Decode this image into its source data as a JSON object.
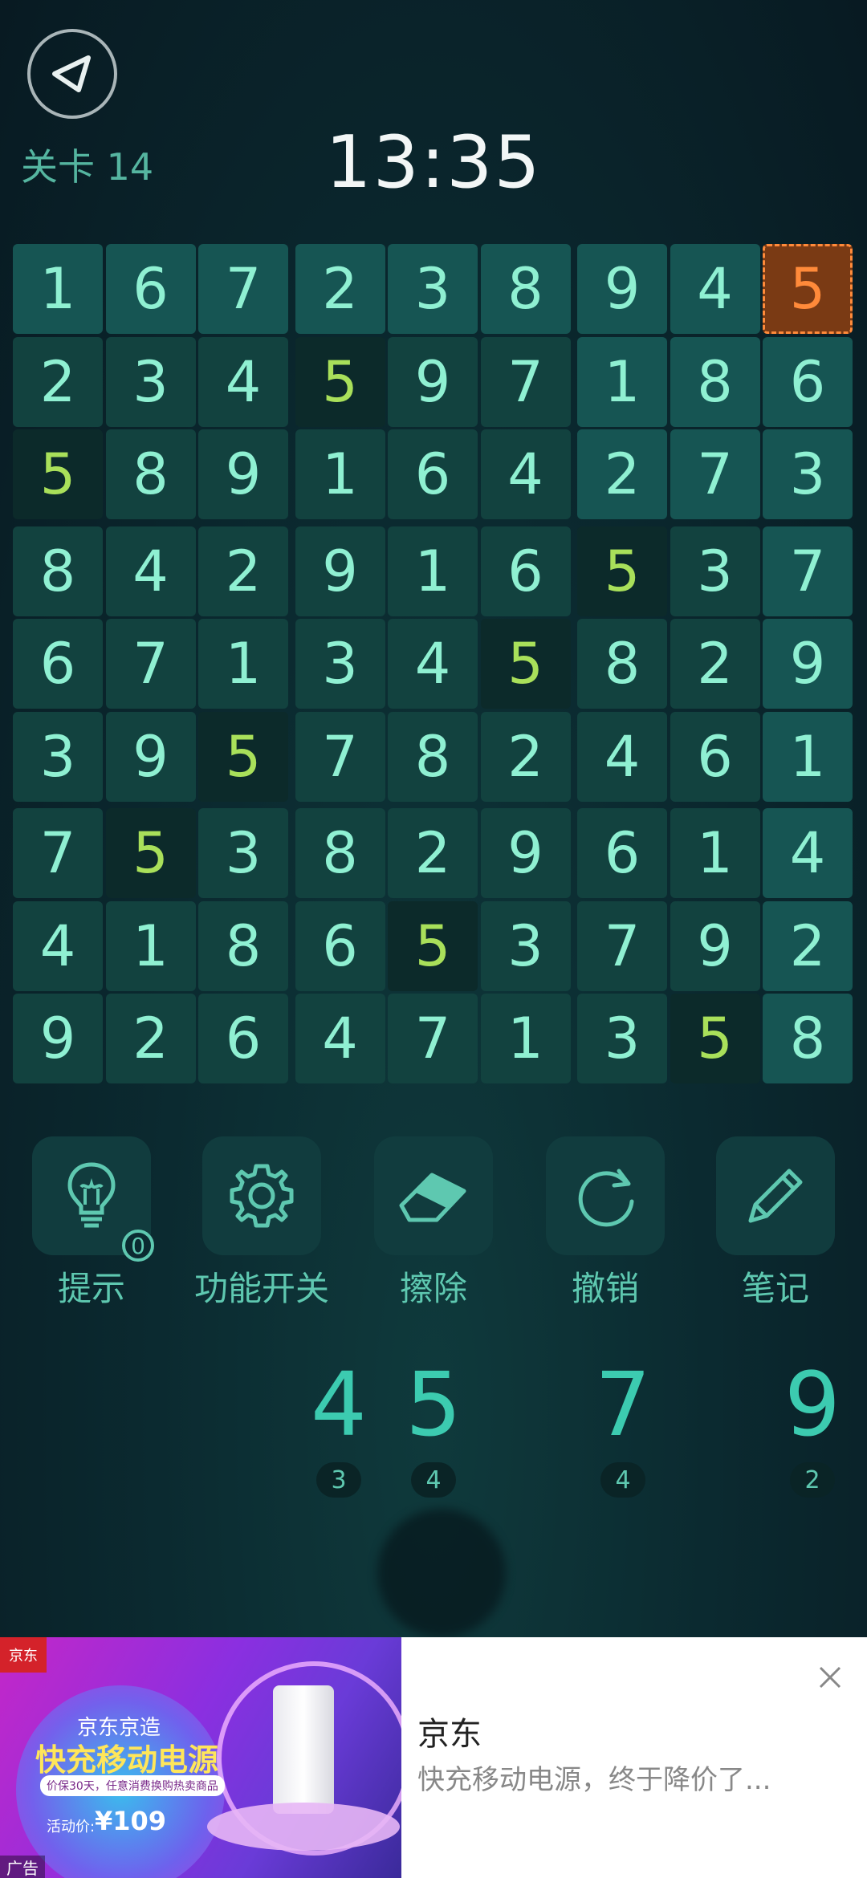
{
  "header": {
    "level_label": "关卡 14",
    "timer": "13:35"
  },
  "board": {
    "rows": [
      [
        1,
        6,
        7,
        2,
        3,
        8,
        9,
        4,
        5
      ],
      [
        2,
        3,
        4,
        5,
        9,
        7,
        1,
        8,
        6
      ],
      [
        5,
        8,
        9,
        1,
        6,
        4,
        2,
        7,
        3
      ],
      [
        8,
        4,
        2,
        9,
        1,
        6,
        5,
        3,
        7
      ],
      [
        6,
        7,
        1,
        3,
        4,
        5,
        8,
        2,
        9
      ],
      [
        3,
        9,
        5,
        7,
        8,
        2,
        4,
        6,
        1
      ],
      [
        7,
        5,
        3,
        8,
        2,
        9,
        6,
        1,
        4
      ],
      [
        4,
        1,
        8,
        6,
        5,
        3,
        7,
        9,
        2
      ],
      [
        9,
        2,
        6,
        4,
        7,
        1,
        3,
        5,
        8
      ]
    ],
    "selected_cell": {
      "row": 0,
      "col": 8
    },
    "highlight_value": 5,
    "colors": {
      "cell_default": "#165553",
      "cell_dim": "#12423f",
      "cell_dark": "#0c2a2a",
      "digit_default": "#8ff0d2",
      "digit_highlight": "#a9e05a",
      "selected_bg": "#7a3a14",
      "selected_digit": "#ff8a3a",
      "selected_border": "#ff8a3a"
    }
  },
  "tools": [
    {
      "label": "提示",
      "icon": "lightbulb-icon",
      "badge": "0"
    },
    {
      "label": "功能开关",
      "icon": "gear-icon"
    },
    {
      "label": "擦除",
      "icon": "eraser-icon"
    },
    {
      "label": "撤销",
      "icon": "undo-icon"
    },
    {
      "label": "笔记",
      "icon": "pencil-icon"
    }
  ],
  "number_picker": [
    {
      "digit": "4",
      "remaining": "3"
    },
    {
      "digit": "5",
      "remaining": "4"
    },
    {
      "digit": "7",
      "remaining": "4"
    },
    {
      "digit": "9",
      "remaining": "2"
    }
  ],
  "ad": {
    "brand_tag": "京东",
    "banner_line1": "京东京造",
    "banner_line2": "快充移动电源",
    "banner_line3": "价保30天，任意消费换购热卖商品",
    "price_label": "活动价:",
    "price_value": "¥109",
    "ad_label": "广告",
    "title": "京东",
    "description": "快充移动电源，终于降价了..."
  }
}
